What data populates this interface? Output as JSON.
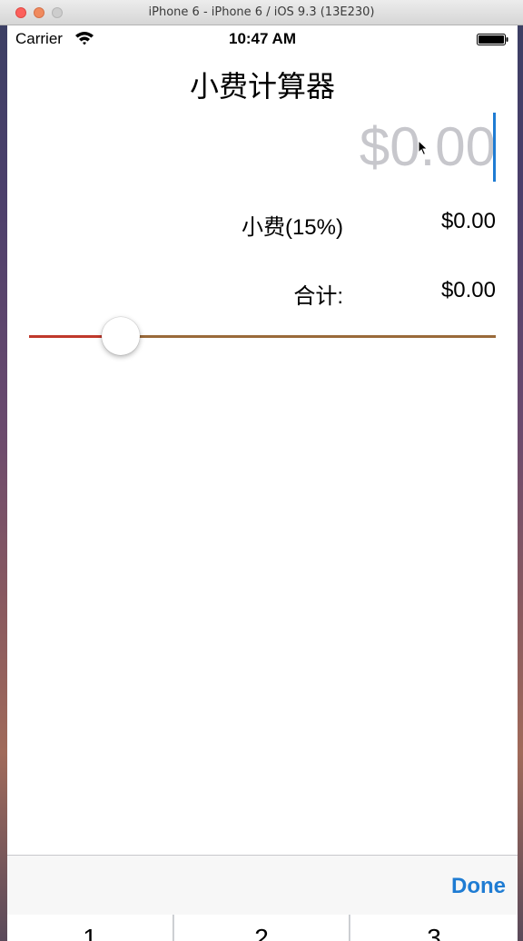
{
  "window": {
    "title": "iPhone 6 - iPhone 6 / iOS 9.3 (13E230)"
  },
  "status_bar": {
    "carrier": "Carrier",
    "time": "10:47 AM"
  },
  "app": {
    "title": "小费计算器",
    "bill_placeholder": "$0.00",
    "tip_label": "小费(15%)",
    "tip_value": "$0.00",
    "total_label": "合计:",
    "total_value": "$0.00",
    "slider_value_fraction": 0.18
  },
  "keyboard_toolbar": {
    "done_label": "Done"
  },
  "keyboard": {
    "keys": [
      "1",
      "2",
      "3"
    ]
  },
  "colors": {
    "accent": "#1f7cd3",
    "slider_min_track": "#c0392b",
    "slider_max_track": "#9a6a3a",
    "placeholder": "#c7c7cc"
  }
}
